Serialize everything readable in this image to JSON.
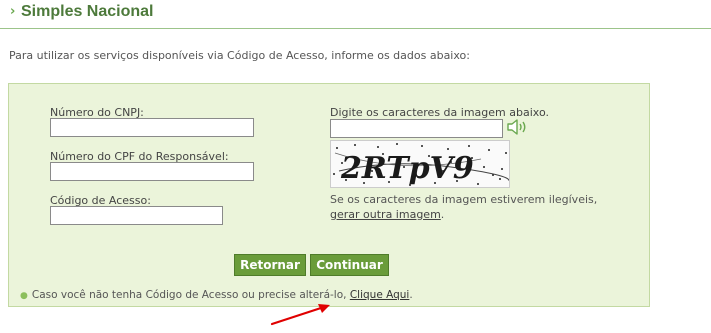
{
  "header": {
    "title": "Simples Nacional"
  },
  "instructions": "Para utilizar os serviços disponíveis via Código de Acesso, informe os dados abaixo:",
  "form": {
    "cnpj_label": "Número do CNPJ:",
    "cnpj_value": "",
    "cpf_label": "Número do CPF do Responsável:",
    "cpf_value": "",
    "codigo_label": "Código de Acesso:",
    "codigo_value": "",
    "captcha_label": "Digite os caracteres da imagem abaixo.",
    "captcha_value": "",
    "captcha_text": "2RTpV9",
    "captcha_hint": "Se os caracteres da imagem estiverem ilegíveis,",
    "captcha_regen_link": "gerar outra imagem",
    "captcha_hint_end": "."
  },
  "buttons": {
    "retornar": "Retornar",
    "continuar": "Continuar"
  },
  "note": {
    "text": "Caso você não tenha Código de Acesso ou precise alterá-lo,",
    "link": "Clique Aqui",
    "end": "."
  },
  "icons": {
    "title_arrow": "chevron-right-icon",
    "speaker": "speaker-icon",
    "bullet": "bullet-icon"
  },
  "colors": {
    "accent_green": "#4d7a3b",
    "panel_bg": "#ebf4da",
    "button_green": "#6a9c3a",
    "annotation_red": "#e00000"
  }
}
